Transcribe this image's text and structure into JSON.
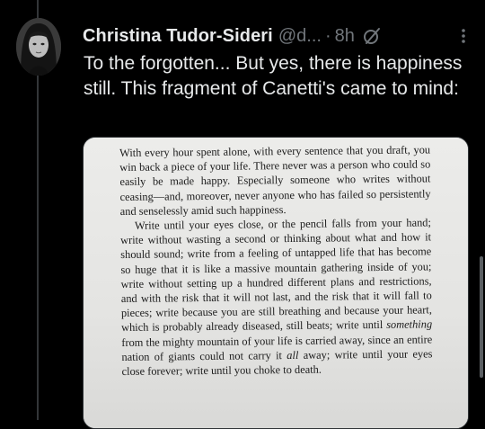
{
  "tweet": {
    "author": {
      "display_name": "Christina Tudor-Sideri",
      "handle": "@d...",
      "avatar_icon": "avatar-portrait"
    },
    "separator": "·",
    "timestamp": "8h",
    "text": "To the forgotten... But yes, there is happiness still. This fragment of Canetti's came to mind:",
    "icons": {
      "grok": "grok-icon",
      "more": "more-options-icon"
    }
  },
  "media": {
    "paragraph_1": "With every hour spent alone, with every sentence that you draft, you win back a piece of your life. There never was a person who could so easily be made happy. Especially someone who writes without ceasing—and, moreover, never anyone who has failed so persistently and senselessly amid such happiness.",
    "paragraph_2_part_1": "Write until your eyes close, or the pencil falls from your hand; write without wasting a second or thinking about what and how it should sound; write from a feeling of untapped life that has become so huge that it is like a massive mountain gathering inside of you; write without setting up a hundred different plans and restrictions, and with the risk that it will not last, and the risk that it will fall to pieces; write because you are still breathing and because your heart, which is probably already diseased, still beats; write until ",
    "paragraph_2_emph_1": "something",
    "paragraph_2_part_2": " from the mighty mountain of your life is carried away, since an entire nation of giants could not carry it ",
    "paragraph_2_emph_2": "all",
    "paragraph_2_part_3": " away; write until your eyes close forever; write until you choke to death."
  },
  "colors": {
    "background": "#000000",
    "text_primary": "#e7e9ea",
    "text_secondary": "#71767b",
    "thread_line": "#333639"
  }
}
